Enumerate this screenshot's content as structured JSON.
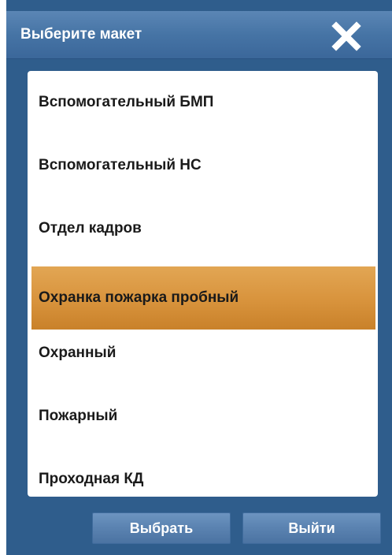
{
  "dialog": {
    "title": "Выберите макет"
  },
  "layouts": {
    "items": [
      {
        "label": "Вспомогательный БМП",
        "selected": false
      },
      {
        "label": "Вспомогательный НС",
        "selected": false
      },
      {
        "label": "Отдел кадров",
        "selected": false
      },
      {
        "label": "Охранка пожарка пробный",
        "selected": true
      },
      {
        "label": "Охранный",
        "selected": false
      },
      {
        "label": "Пожарный",
        "selected": false
      },
      {
        "label": "Проходная КД",
        "selected": false
      }
    ]
  },
  "buttons": {
    "select_label": "Выбрать",
    "exit_label": "Выйти"
  },
  "colors": {
    "window_bg": "#2f5d8c",
    "selection": "#d8933c",
    "button": "#5a82b0"
  },
  "icons": {
    "close": "close-icon"
  }
}
